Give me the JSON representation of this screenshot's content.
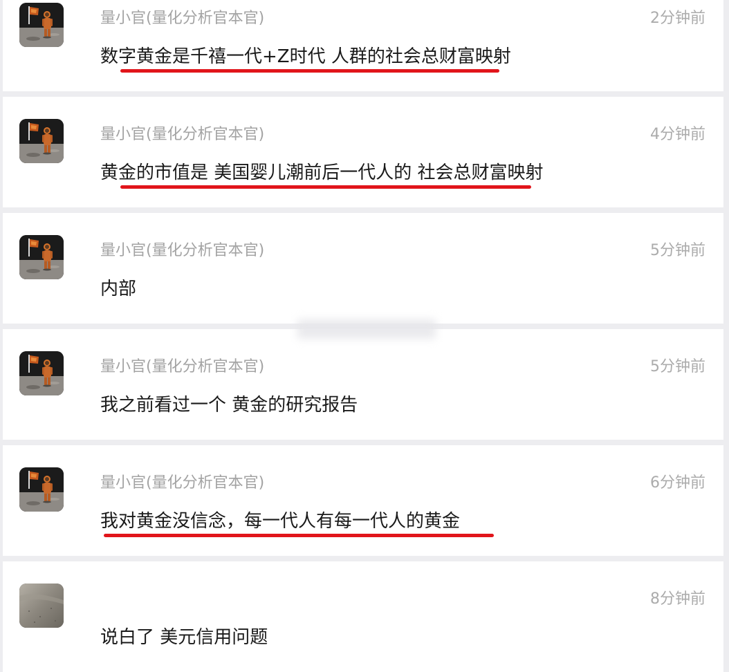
{
  "comments": [
    {
      "username": "量小官(量化分析官本官)",
      "time": "2分钟前",
      "text": "数字黄金是千禧一代+Z时代 人群的社会总财富映射",
      "underlined": true,
      "avatar": "astronaut-on-moon"
    },
    {
      "username": "量小官(量化分析官本官)",
      "time": "4分钟前",
      "text": "黄金的市值是 美国婴儿潮前后一代人的 社会总财富映射",
      "underlined": true,
      "avatar": "astronaut-on-moon"
    },
    {
      "username": "量小官(量化分析官本官)",
      "time": "5分钟前",
      "text": "内部",
      "underlined": false,
      "avatar": "astronaut-on-moon"
    },
    {
      "username": "量小官(量化分析官本官)",
      "time": "5分钟前",
      "text": "我之前看过一个 黄金的研究报告",
      "underlined": false,
      "avatar": "astronaut-on-moon"
    },
    {
      "username": "量小官(量化分析官本官)",
      "time": "6分钟前",
      "text": "我对黄金没信念，每一代人有每一代人的黄金",
      "underlined": true,
      "avatar": "astronaut-on-moon"
    },
    {
      "username": "",
      "time": "8分钟前",
      "text": "说白了 美元信用问题",
      "underlined": false,
      "avatar": "gray-textured-photo"
    }
  ],
  "colors": {
    "background": "#ededf0",
    "card": "#ffffff",
    "username": "#a3a3a3",
    "time": "#ababab",
    "message": "#1a1a1a",
    "underline": "#e1151b"
  }
}
